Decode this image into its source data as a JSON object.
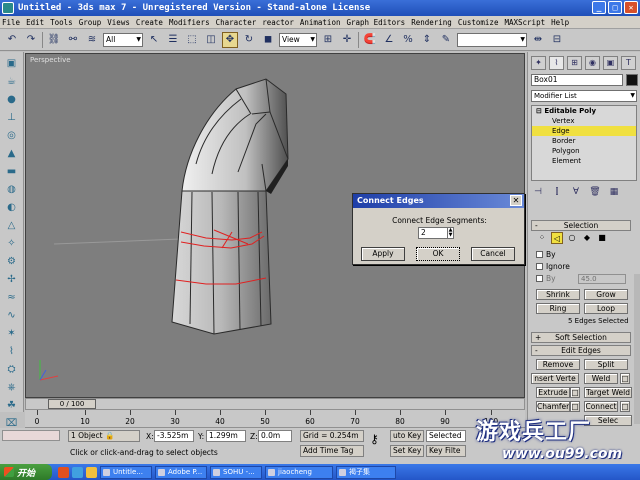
{
  "window": {
    "title": "Untitled - 3ds max 7  - Unregistered Version - Stand-alone License"
  },
  "menu": [
    "File",
    "Edit",
    "Tools",
    "Group",
    "Views",
    "Create",
    "Modifiers",
    "Character",
    "reactor",
    "Animation",
    "Graph Editors",
    "Rendering",
    "Customize",
    "MAXScript",
    "Help"
  ],
  "toolbar": {
    "selection_filter": "All",
    "ref_coord": "View"
  },
  "viewport": {
    "label": "Perspective"
  },
  "dialog": {
    "title": "Connect Edges",
    "segments_label": "Connect Edge Segments:",
    "segments_value": "2",
    "apply": "Apply",
    "ok": "OK",
    "cancel": "Cancel"
  },
  "panel": {
    "object_name": "Box01",
    "modifier_list": "Modifier List",
    "stack": {
      "root": "Editable Poly",
      "items": [
        "Vertex",
        "Edge",
        "Border",
        "Polygon",
        "Element"
      ],
      "selected": "Edge"
    },
    "selection_rollout": "Selection",
    "by_vertex": "By",
    "ignore_backfacing": "Ignore",
    "by_angle": "By",
    "angle_value": "45.0",
    "shrink": "Shrink",
    "grow": "Grow",
    "ring": "Ring",
    "loop": "Loop",
    "status": "5 Edges Selected",
    "soft_selection": "Soft Selection",
    "edit_edges": "Edit Edges",
    "remove": "Remove",
    "split": "Split",
    "insert_vertex": "nsert Verte",
    "weld": "Weld",
    "extrude": "Extrude",
    "target_weld": "Target Weld",
    "chamfer": "Chamfer",
    "connect": "Connect",
    "create_shape": "Selec"
  },
  "timeline": {
    "slider": "0 / 100",
    "ticks": [
      "0",
      "10",
      "20",
      "30",
      "40",
      "50",
      "60",
      "70",
      "80",
      "90",
      "100"
    ]
  },
  "status": {
    "selection": "1 Object",
    "prompt": "Click or click-and-drag to select objects",
    "x": "-3.525m",
    "y": "1.299m",
    "z": "0.0m",
    "x_label": "X:",
    "y_label": "Y:",
    "z_label": "Z:",
    "grid": "Grid = 0.254m",
    "add_time_tag": "Add Time Tag",
    "auto_key": "uto Key",
    "set_key": "Set Key",
    "selected": "Selected",
    "key_filters": "Key Filte"
  },
  "taskbar": {
    "start": "开始",
    "items": [
      "Untitle...",
      "Adobe P...",
      "SOHU -...",
      "jiaocheng",
      "褐子集"
    ]
  },
  "watermark": {
    "title": "游戏兵工厂",
    "url": "www.ou99.com"
  },
  "colors": {
    "selected_highlight": "#f0e040",
    "titlebar": "#1f4fb8",
    "viewport_bg": "#7e7e7e"
  }
}
